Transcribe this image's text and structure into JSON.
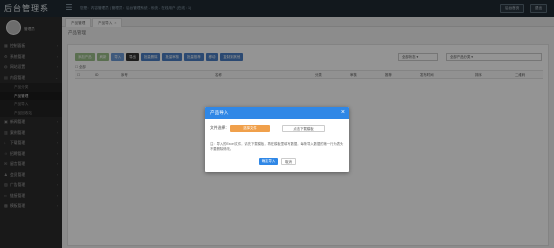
{
  "app": {
    "title": "后台管理系"
  },
  "header": {
    "notice": "您是：内容管理员 | 管理员：后台管理系统 - 系统 - 在线用户 (在线 : 1)",
    "buttons": [
      {
        "label": "后台首页"
      },
      {
        "label": "退出"
      }
    ]
  },
  "sidebar": {
    "username": "管理员",
    "items": [
      {
        "label": "控制面板",
        "icon": "dashboard-icon"
      },
      {
        "label": "系统管理",
        "icon": "settings-icon"
      },
      {
        "label": "网站设置",
        "icon": "globe-icon"
      },
      {
        "label": "内容管理",
        "icon": "document-icon"
      }
    ],
    "subitems": [
      {
        "label": "产品分类"
      },
      {
        "label": "产品管理"
      },
      {
        "label": "产品导入"
      },
      {
        "label": "产品回收站"
      }
    ],
    "items_after": [
      {
        "label": "新闻管理"
      },
      {
        "label": "案例管理"
      },
      {
        "label": "下载管理"
      },
      {
        "label": "招聘管理"
      },
      {
        "label": "留言管理"
      },
      {
        "label": "会员管理"
      },
      {
        "label": "广告管理"
      },
      {
        "label": "链接管理"
      },
      {
        "label": "模板管理"
      }
    ]
  },
  "tabs": [
    {
      "label": "产品管理"
    },
    {
      "label": "产品导入"
    }
  ],
  "page": {
    "heading": "产品管理",
    "toolbar": [
      {
        "label": "添加产品",
        "color": "#9bc08a"
      },
      {
        "label": "刷新",
        "color": "#9bc08a"
      },
      {
        "label": "导入",
        "color": "#6b9ad6"
      },
      {
        "label": "导出",
        "color": "#333333"
      },
      {
        "label": "批量删除",
        "color": "#4a7fc4"
      },
      {
        "label": "批量审核",
        "color": "#4a7fc4"
      },
      {
        "label": "批量推荐",
        "color": "#4a7fc4"
      },
      {
        "label": "移动",
        "color": "#4a7fc4"
      },
      {
        "label": "复制到其他",
        "color": "#4a7fc4"
      }
    ],
    "select_status": "全部状态",
    "select_category": "全部产品分类",
    "filter_text": "全部",
    "columns": [
      "ID",
      "序号",
      "名称",
      "分类",
      "审核",
      "推荐",
      "发布时间",
      "排序",
      "二维码"
    ]
  },
  "modal": {
    "title": "产品导入",
    "file_label": "文件选择：",
    "choose_button": "选择文件",
    "template_button": "点击下载模板",
    "note": "注：导入的Excel文件，请先下载模板，再在模板里填写数据，每条导入数据的第一行为表头不要删除修改。",
    "confirm": "确定导入",
    "cancel": "取消"
  }
}
